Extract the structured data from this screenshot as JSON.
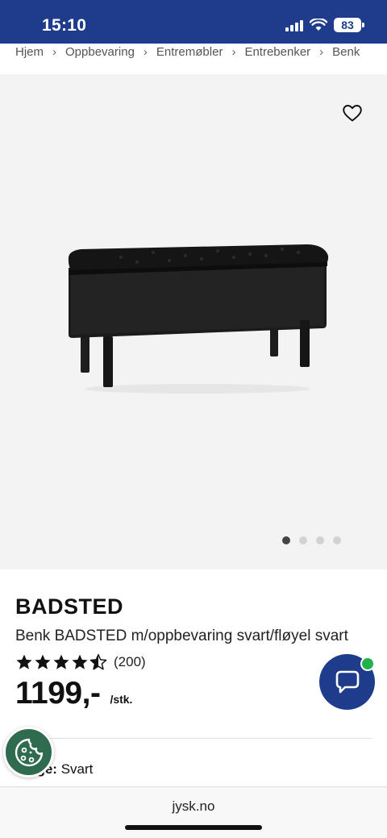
{
  "status_bar": {
    "time": "15:10",
    "battery": "83",
    "icons": [
      "signal-icon",
      "wifi-icon",
      "battery-icon"
    ]
  },
  "breadcrumb": [
    "Hjem",
    "Oppbevaring",
    "Entremøbler",
    "Entrebenker",
    "Benk"
  ],
  "product": {
    "favorite_icon": "heart-outline-icon",
    "image_alt": "black velvet storage bench",
    "gallery": {
      "image_count": 4,
      "active_index": 0
    },
    "brand": "BADSTED",
    "title": "Benk BADSTED m/oppbevaring svart/fløyel svart",
    "rating": 4.5,
    "review_count": "(200)",
    "price": "1199,-",
    "unit": "/stk.",
    "color_label": "Farge:",
    "color_value": "Svart"
  },
  "chat": {
    "icon": "chat-bubble-icon",
    "status_color": "#22b24c"
  },
  "cookie": {
    "icon": "cookie-icon"
  },
  "browser": {
    "url": "jysk.no"
  },
  "colors": {
    "brand_blue": "#1f3c8c",
    "cookie_green": "#2e6b4f"
  }
}
